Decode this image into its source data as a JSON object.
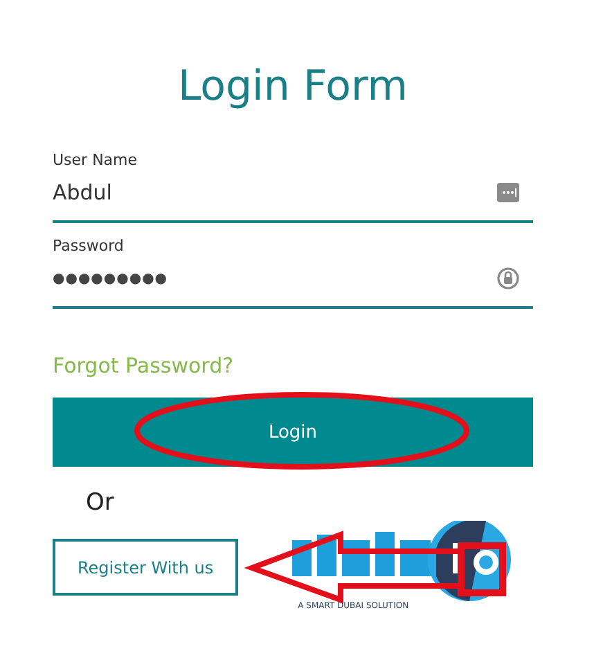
{
  "title": "Login Form",
  "fields": [
    {
      "label": "User Name",
      "value": "Abdul",
      "kind": "text"
    },
    {
      "label": "Password",
      "value": "●●●●●●●●●",
      "kind": "password"
    }
  ],
  "forgot_link": "Forgot Password?",
  "login_button": "Login",
  "separator": "Or",
  "register_button": "Register With us",
  "logo": {
    "tagline": "A SMART DUBAI SOLUTION"
  },
  "annotations": [
    {
      "kind": "ellipse"
    },
    {
      "kind": "arrow"
    },
    {
      "kind": "box"
    }
  ]
}
